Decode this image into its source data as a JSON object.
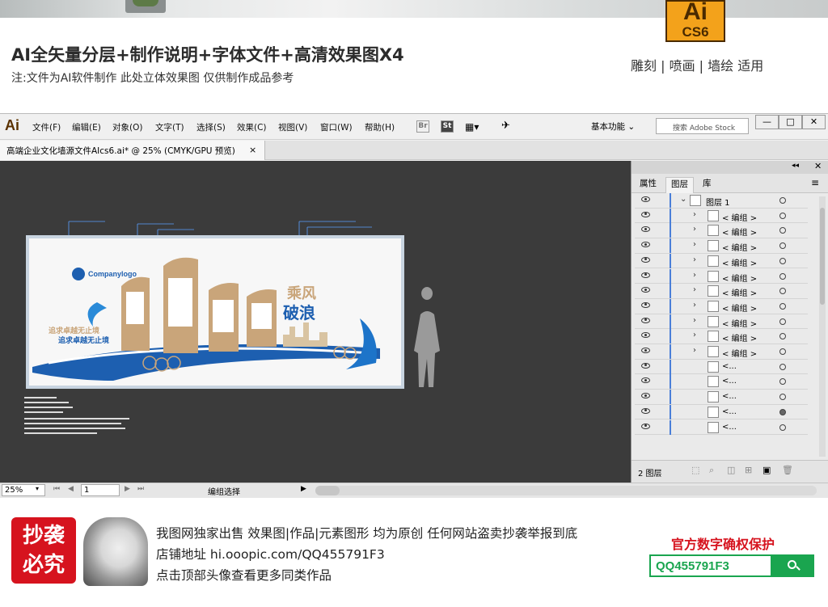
{
  "banner": {
    "headline": "AI全矢量分层+制作说明+字体文件+高清效果图X4",
    "note": "注:文件为AI软件制作 此处立体效果图 仅供制作成品参考",
    "tags": "雕刻 | 喷画 | 墙绘 适用",
    "badge_top": "Ai",
    "badge_bottom": "CS6"
  },
  "app": {
    "logo": "Ai",
    "menus": [
      "文件(F)",
      "编辑(E)",
      "对象(O)",
      "文字(T)",
      "选择(S)",
      "效果(C)",
      "视图(V)",
      "窗口(W)",
      "帮助(H)"
    ],
    "bridge": "Br",
    "stock_btn": "St",
    "workspace": "基本功能",
    "stock_search_placeholder": "搜索 Adobe Stock",
    "window_buttons": [
      "—",
      "□",
      "✕"
    ],
    "doc_tab": "高端企业文化墙源文件AIcs6.ai* @ 25% (CMYK/GPU 预览)",
    "doc_close": "×"
  },
  "artboard": {
    "company_logo": "Companylogo",
    "slogan_line1": "追求卓越无止境",
    "slogan_line2": "追求卓越无止境",
    "calligraphy_top": "乘风",
    "calligraphy_bottom": "破浪"
  },
  "layers": {
    "tabs": [
      "属性",
      "图层",
      "库"
    ],
    "active_tab": "图层",
    "top_layer": "图层 1",
    "rows": [
      {
        "label": "< 编组 >",
        "expand": true,
        "filled": false
      },
      {
        "label": "< 编组 >",
        "expand": true,
        "filled": false
      },
      {
        "label": "< 编组 >",
        "expand": true,
        "filled": false
      },
      {
        "label": "< 编组 >",
        "expand": true,
        "filled": false
      },
      {
        "label": "< 编组 >",
        "expand": true,
        "filled": false
      },
      {
        "label": "< 编组 >",
        "expand": true,
        "filled": false
      },
      {
        "label": "< 编组 >",
        "expand": true,
        "filled": false
      },
      {
        "label": "< 编组 >",
        "expand": true,
        "filled": false
      },
      {
        "label": "< 编组 >",
        "expand": true,
        "filled": false
      },
      {
        "label": "< 编组 >",
        "expand": true,
        "filled": false
      },
      {
        "label": "<...",
        "expand": false,
        "filled": false
      },
      {
        "label": "<...",
        "expand": false,
        "filled": false
      },
      {
        "label": "<...",
        "expand": false,
        "filled": false
      },
      {
        "label": "<...",
        "expand": false,
        "filled": true
      },
      {
        "label": "<...",
        "expand": false,
        "filled": false
      }
    ],
    "footer_count": "2 图层"
  },
  "status": {
    "zoom": "25%",
    "page": "1",
    "tool": "编组选择"
  },
  "footer": {
    "stamp_line1": "抄袭",
    "stamp_line2": "必究",
    "line1": "我图网独家出售 效果图|作品|元素图形 均为原创 任何网站盗卖抄袭举报到底",
    "line2": "店铺地址 hi.ooopic.com/QQ455791F3",
    "line3": "点击顶部头像查看更多同类作品",
    "protect_title": "官方数字确权保护",
    "protect_code": "QQ455791F3"
  },
  "colors": {
    "accent_blue": "#1d5fb0",
    "wood": "#c9a57a",
    "brand_red": "#d6131e",
    "brand_green": "#1aa54f",
    "canvas_bg": "#3b3b3b"
  }
}
